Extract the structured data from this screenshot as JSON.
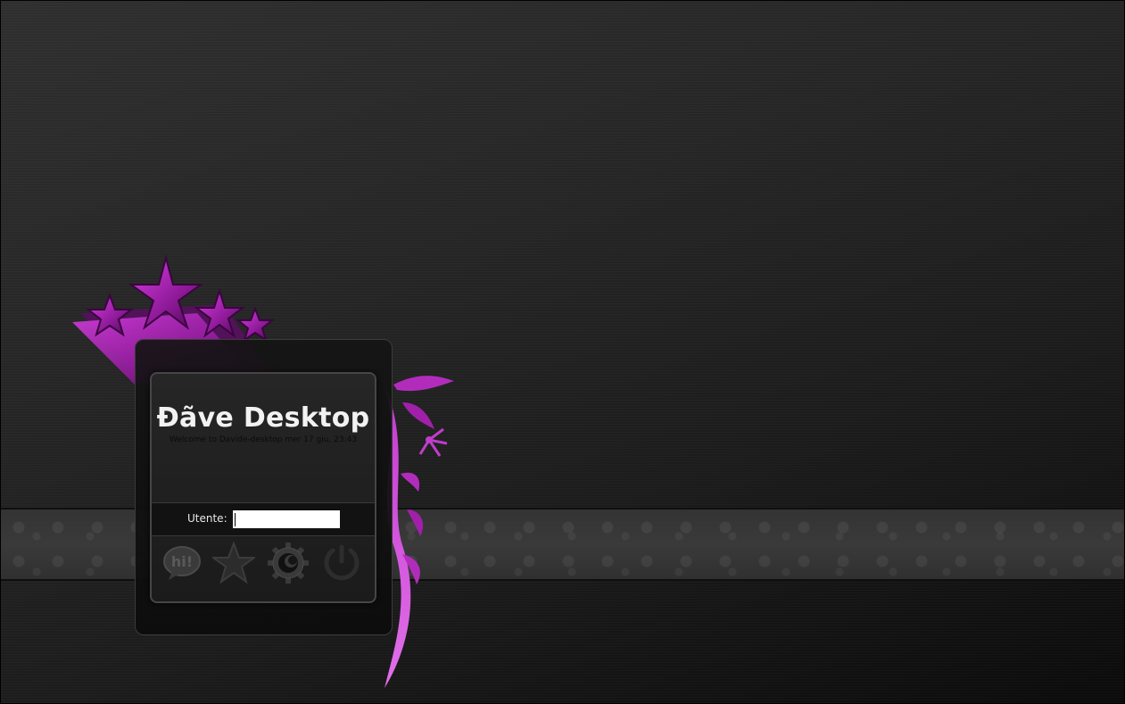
{
  "login": {
    "hostname": "Đãve Desktop",
    "welcome": "Welcome to Davide-desktop  mer 17 giu, 23:43",
    "username_label": "Utente:",
    "username_value": ""
  },
  "actions": [
    {
      "icon": "chat-hi-icon",
      "label": "Chat"
    },
    {
      "icon": "star-icon",
      "label": "Favorite"
    },
    {
      "icon": "gear-icon",
      "label": "Options"
    },
    {
      "icon": "shutdown-icon",
      "label": "Shutdown"
    }
  ],
  "colors": {
    "accent": "#c02cc8",
    "panel": "#222222",
    "text": "#f2f2f2"
  }
}
